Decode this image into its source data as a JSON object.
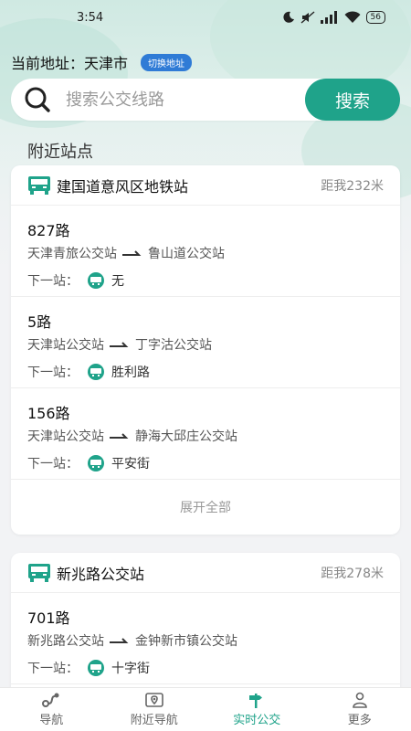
{
  "status_bar": {
    "time": "3:54",
    "battery": "56"
  },
  "address": {
    "label": "当前地址：",
    "city": "天津市",
    "switch_label": "切换地址"
  },
  "search": {
    "placeholder": "搜索公交线路",
    "button_label": "搜索"
  },
  "section_title": "附近站点",
  "stations": [
    {
      "name": "建国道意风区地铁站",
      "distance": "距我232米",
      "routes": [
        {
          "name": "827路",
          "from": "天津青旅公交站",
          "to": "鲁山道公交站",
          "next_label": "下一站：",
          "next_stop": "无"
        },
        {
          "name": "5路",
          "from": "天津站公交站",
          "to": "丁字沽公交站",
          "next_label": "下一站：",
          "next_stop": "胜利路"
        },
        {
          "name": "156路",
          "from": "天津站公交站",
          "to": "静海大邱庄公交站",
          "next_label": "下一站：",
          "next_stop": "平安街"
        }
      ],
      "expand_label": "展开全部"
    },
    {
      "name": "新兆路公交站",
      "distance": "距我278米",
      "routes": [
        {
          "name": "701路",
          "from": "新兆路公交站",
          "to": "金钟新市镇公交站",
          "next_label": "下一站：",
          "next_stop": "十字街"
        }
      ]
    }
  ],
  "tabs": [
    {
      "label": "导航",
      "icon": "route-icon",
      "active": false
    },
    {
      "label": "附近导航",
      "icon": "map-pin-icon",
      "active": false
    },
    {
      "label": "实时公交",
      "icon": "direction-sign-icon",
      "active": true
    },
    {
      "label": "更多",
      "icon": "user-icon",
      "active": false
    }
  ],
  "colors": {
    "accent": "#1fa38a",
    "switch_button": "#2f7bd6"
  }
}
